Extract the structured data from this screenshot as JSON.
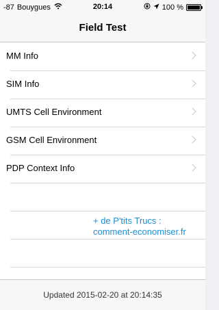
{
  "status": {
    "signal": "-87",
    "carrier": "Bouygues",
    "time": "20:14",
    "battery": "100 %",
    "battery_level": 1.0,
    "icons": [
      "wifi-icon",
      "rotation-lock-icon",
      "location-arrow-icon",
      "battery-icon"
    ]
  },
  "nav": {
    "title": "Field Test"
  },
  "list": {
    "items": [
      {
        "label": "MM Info"
      },
      {
        "label": "SIM Info"
      },
      {
        "label": "UMTS Cell Environment"
      },
      {
        "label": "GSM Cell Environment"
      },
      {
        "label": "PDP Context Info"
      }
    ]
  },
  "promo": {
    "line1": "+ de P'tits Trucs :",
    "line2": "comment-economiser.fr",
    "color": "#1a8fd6"
  },
  "footer": {
    "updated": "Updated 2015-02-20 at 20:14:35"
  }
}
